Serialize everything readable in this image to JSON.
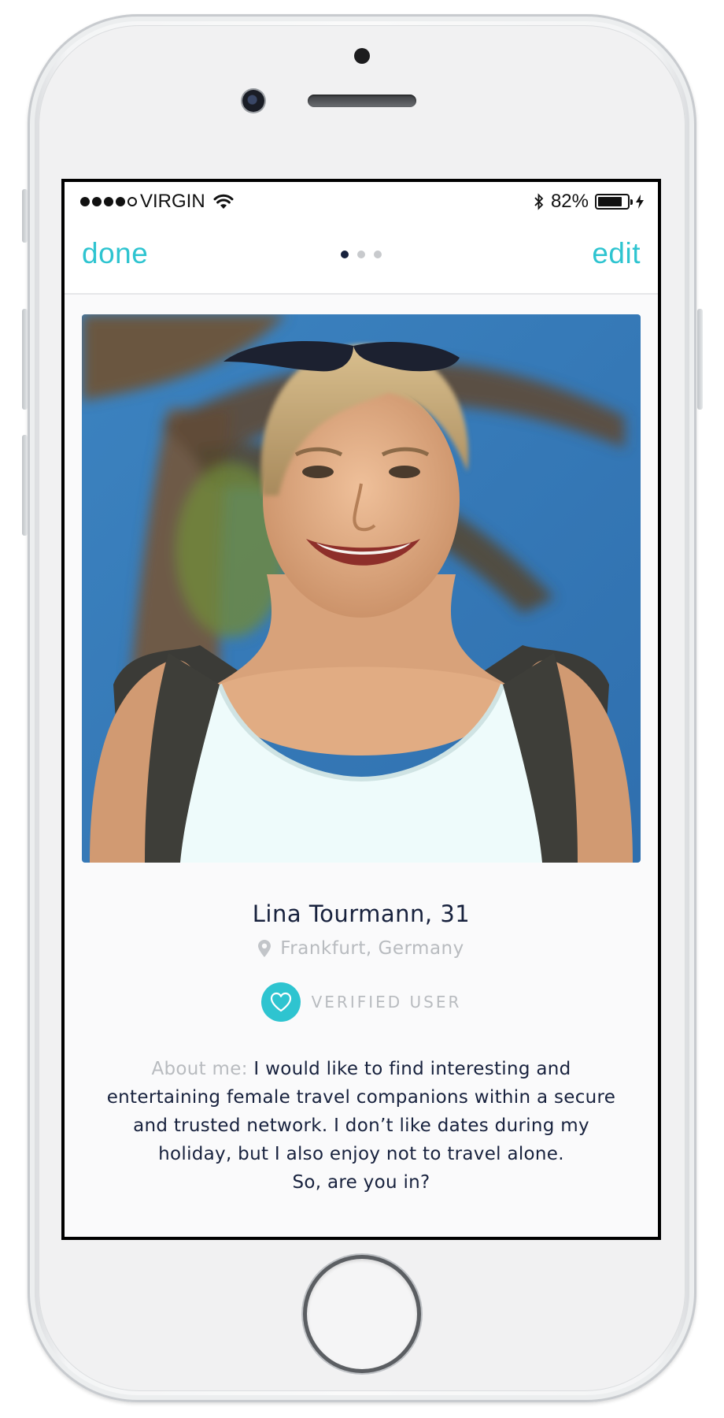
{
  "status_bar": {
    "carrier": "VIRGIN",
    "signal_bars_filled": 4,
    "signal_bars_total": 5,
    "battery": "82%",
    "battery_level": 0.82,
    "icons": [
      "wifi-icon",
      "bluetooth-icon",
      "battery-icon",
      "charging-bolt-icon"
    ]
  },
  "nav": {
    "left_label": "done",
    "right_label": "edit",
    "pages": 3,
    "active_page": 1
  },
  "profile": {
    "name": "Lina Tourmann, 31",
    "location": "Frankfurt, Germany",
    "verified_label": "VERIFIED USER",
    "about_label": "About me:",
    "about_line1": "I would like to find interesting and",
    "about_line2": "entertaining female travel companions within a secure",
    "about_line3": "and trusted network. I don’t like dates during my",
    "about_line4": "holiday, but I also enjoy not to travel alone.",
    "about_line5": "So, are you in?"
  },
  "colors": {
    "accent": "#2ec4d0",
    "text_dark": "#17213d",
    "text_muted": "#b8bbbf"
  }
}
